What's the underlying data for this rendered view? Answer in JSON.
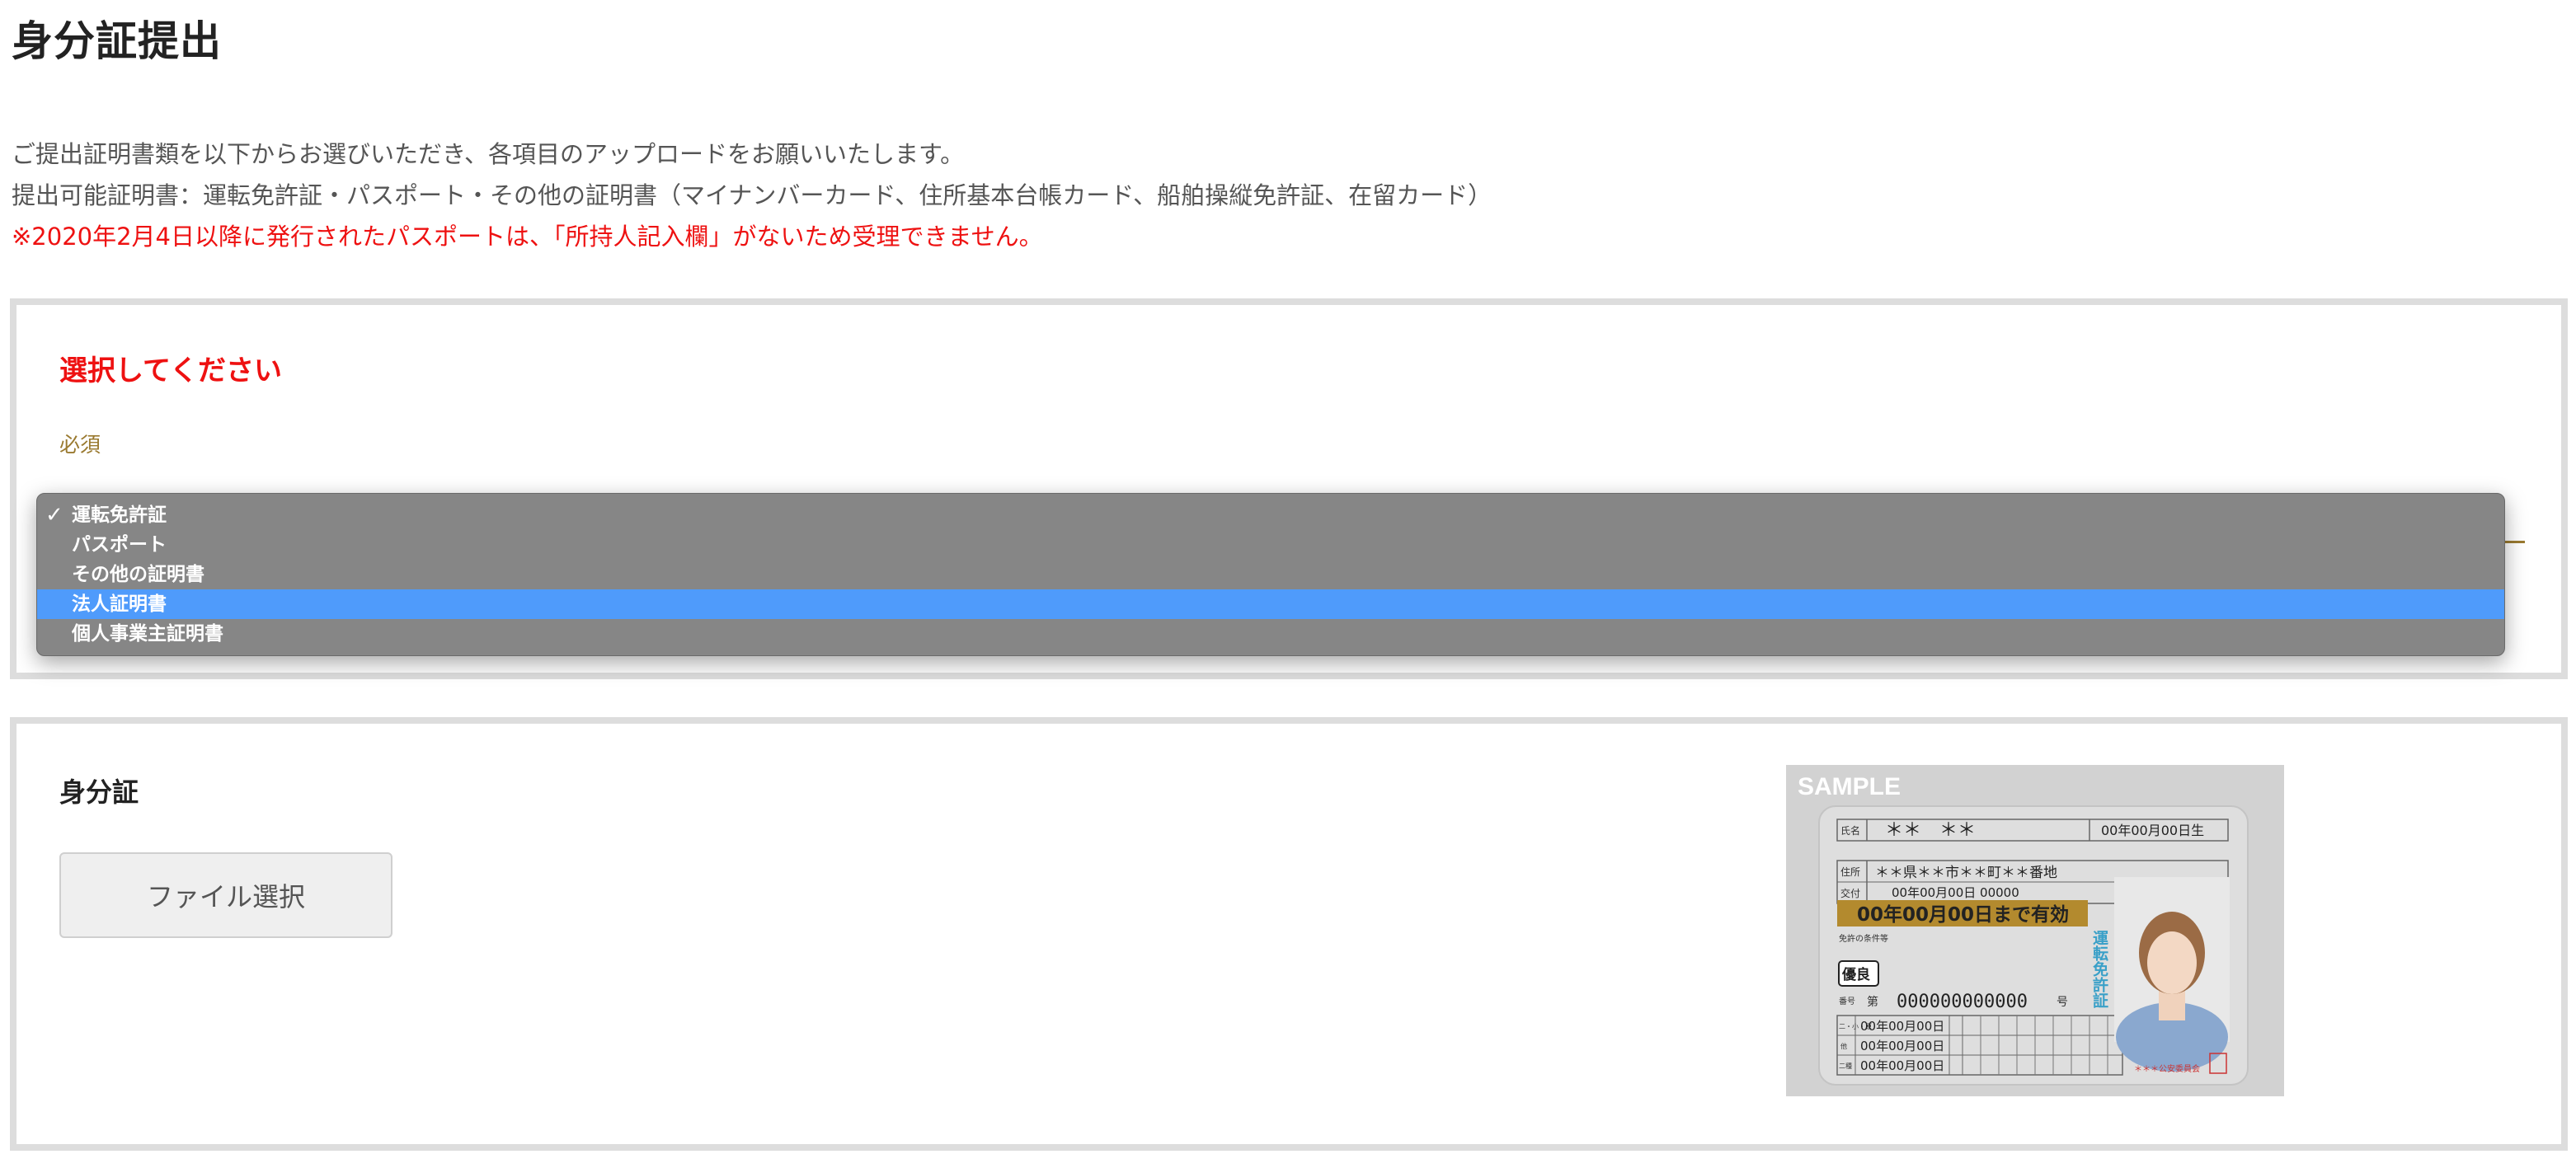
{
  "page": {
    "title": "身分証提出"
  },
  "intro": {
    "line1": "ご提出証明書類を以下からお選びいただき、各項目のアップロードをお願いいたします。",
    "line2": "提出可能証明書：運転免許証・パスポート・その他の証明書（マイナンバーカード、住所基本台帳カード、船舶操縦免許証、在留カード）",
    "warning": "※2020年2月4日以降に発行されたパスポートは、「所持人記入欄」がないため受理できません。"
  },
  "select_section": {
    "heading": "選択してください",
    "required": "必須",
    "options": [
      {
        "label": "運転免許証",
        "checked": true,
        "highlighted": false
      },
      {
        "label": "パスポート",
        "checked": false,
        "highlighted": false
      },
      {
        "label": "その他の証明書",
        "checked": false,
        "highlighted": false
      },
      {
        "label": "法人証明書",
        "checked": false,
        "highlighted": true
      },
      {
        "label": "個人事業主証明書",
        "checked": false,
        "highlighted": false
      }
    ],
    "check_mark": "✓"
  },
  "upload_section": {
    "title": "身分証",
    "file_button": "ファイル選択"
  },
  "sample_card": {
    "watermark": "SAMPLE",
    "name_label": "氏名",
    "name_value": "＊＊　＊＊",
    "birth": "00年00月00日生",
    "address_label": "住所",
    "address_value": "＊＊県＊＊市＊＊町＊＊番地",
    "issue_label": "交付",
    "issue_value": "00年00月00日 00000",
    "expiry": "00年00月00日まで有効",
    "condition_label": "免許の条件等",
    "badge": "優良",
    "number_label": "番号",
    "number_prefix": "第",
    "number_value": "000000000000",
    "number_suffix": "号",
    "license_title": "運転免許証",
    "date_rows": [
      "00年00月00日",
      "00年00月00日",
      "00年00月00日"
    ],
    "row_labels": [
      "二・小・原",
      "他",
      "二種"
    ],
    "seal": "＊＊＊公安委員会",
    "colors": {
      "card_bg": "#d2d2d2",
      "expiry_bar": "#b38a2e",
      "title_text": "#3aa0c8"
    }
  }
}
